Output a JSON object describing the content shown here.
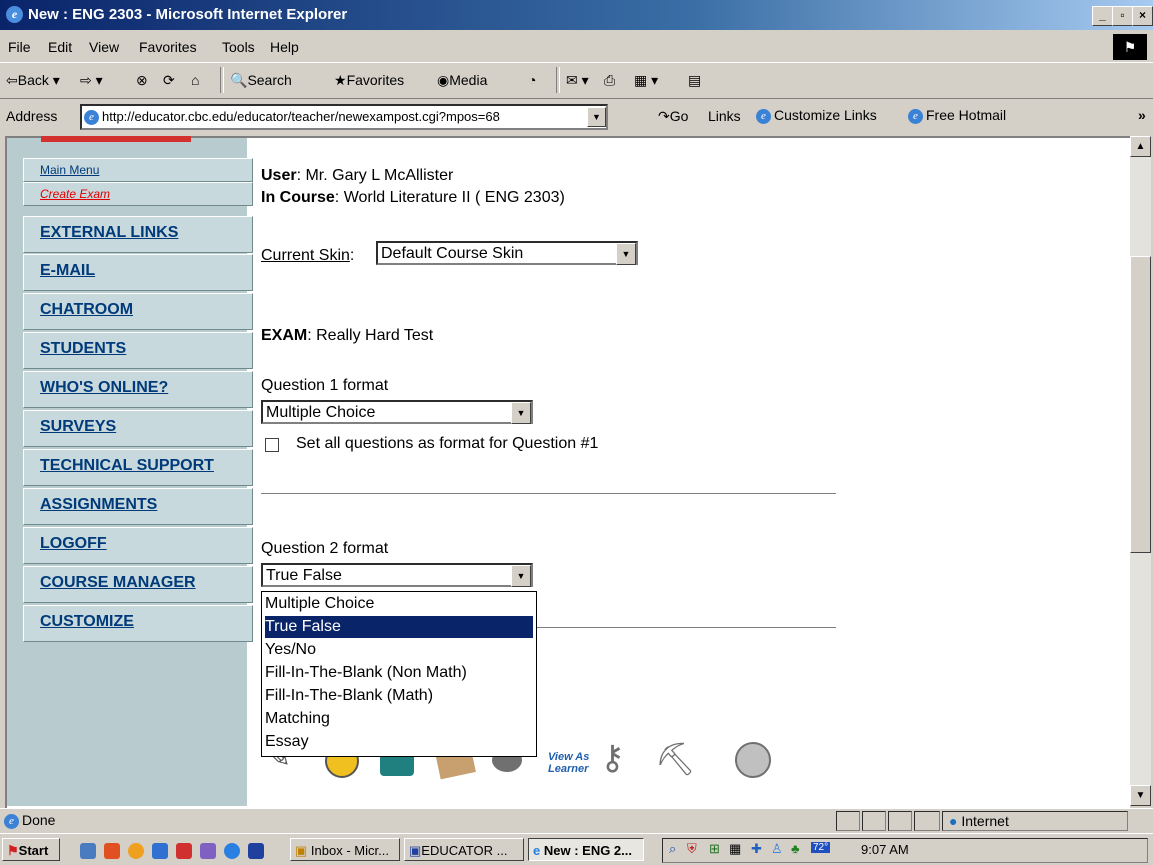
{
  "window": {
    "title": "New : ENG 2303 - Microsoft Internet Explorer",
    "min": "_",
    "max": "▫",
    "close": "×"
  },
  "menu": [
    "File",
    "Edit",
    "View",
    "Favorites",
    "Tools",
    "Help"
  ],
  "toolbar": {
    "back": "Back",
    "search": "Search",
    "favorites": "Favorites",
    "media": "Media"
  },
  "address": {
    "label": "Address",
    "url": "http://educator.cbc.edu/educator/teacher/newexampost.cgi?mpos=68",
    "go": "Go",
    "links": "Links",
    "customize": "Customize Links",
    "hotmail": "Free Hotmail"
  },
  "sidebar": {
    "small": [
      "Main Menu",
      "Create Exam"
    ],
    "items": [
      "EXTERNAL LINKS",
      "E-MAIL",
      "CHATROOM",
      "STUDENTS",
      "WHO'S ONLINE?",
      "SURVEYS",
      "TECHNICAL SUPPORT",
      "ASSIGNMENTS",
      "LOGOFF",
      "COURSE MANAGER",
      "CUSTOMIZE"
    ]
  },
  "main": {
    "user_label": "User",
    "user_value": ": Mr. Gary L McAllister",
    "course_label": "In Course",
    "course_value": ": World Literature II ( ENG 2303)",
    "skin_label": "Current Skin",
    "skin_colon": ":",
    "skin_value": "Default Course Skin",
    "exam_label": "EXAM",
    "exam_value": ": Really Hard Test",
    "q1_label": "Question 1 format",
    "q1_value": "Multiple Choice",
    "set_all_label": "Set all questions as format for Question #1",
    "q2_label": "Question 2 format",
    "q2_value": "True False",
    "q2_options": [
      "Multiple Choice",
      "True False",
      "Yes/No",
      "Fill-In-The-Blank (Non Math)",
      "Fill-In-The-Blank (Math)",
      "Matching",
      "Essay"
    ],
    "q2_selected_index": 1,
    "view_as": "View As",
    "learner": "Learner"
  },
  "status": {
    "text": "Done",
    "zone": "Internet"
  },
  "taskbar": {
    "start": "Start",
    "tasks": [
      "Inbox - Micr...",
      "EDUCATOR ...",
      "New : ENG 2..."
    ],
    "temp": "72°",
    "clock": "9:07 AM"
  }
}
